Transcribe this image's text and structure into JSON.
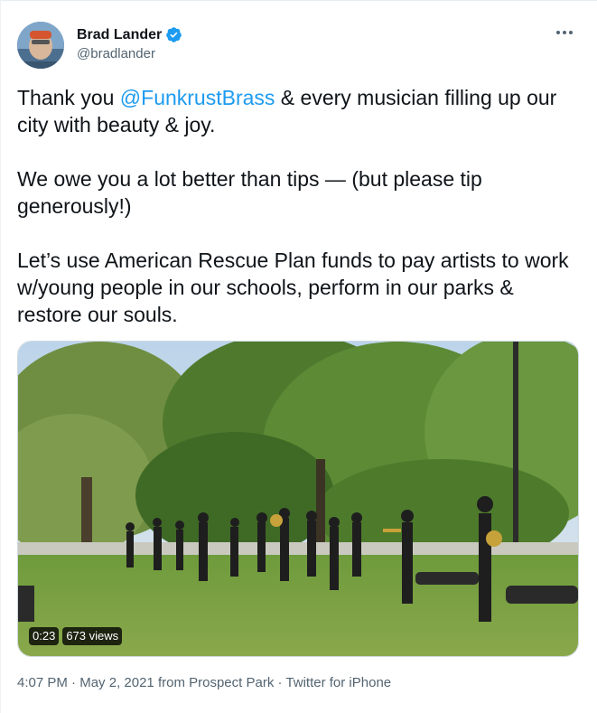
{
  "author": {
    "display_name": "Brad Lander",
    "handle": "@bradlander",
    "verified": true
  },
  "tweet": {
    "p1_before": "Thank you ",
    "p1_mention": "@FunkrustBrass",
    "p1_after": " & every musician filling up our city with beauty & joy.",
    "p2": "We owe you a lot better than tips — (but please tip generously!)",
    "p3": "Let’s use American Rescue Plan funds to pay artists to work w/young people in our schools, perform in our parks & restore our souls."
  },
  "video": {
    "duration": "0:23",
    "views": "673 views"
  },
  "meta": {
    "time": "4:07 PM",
    "sep1": " · ",
    "date": "May 2, 2021",
    "from_word": " from ",
    "place": "Prospect Park",
    "sep2": " · ",
    "source": "Twitter for iPhone"
  },
  "icons": {
    "verified": "verified-badge-icon",
    "more": "more-dots-icon"
  },
  "colors": {
    "mention": "#1d9bf0",
    "secondary_text": "#536471",
    "primary_text": "#0f1419",
    "verified": "#1d9bf0"
  }
}
